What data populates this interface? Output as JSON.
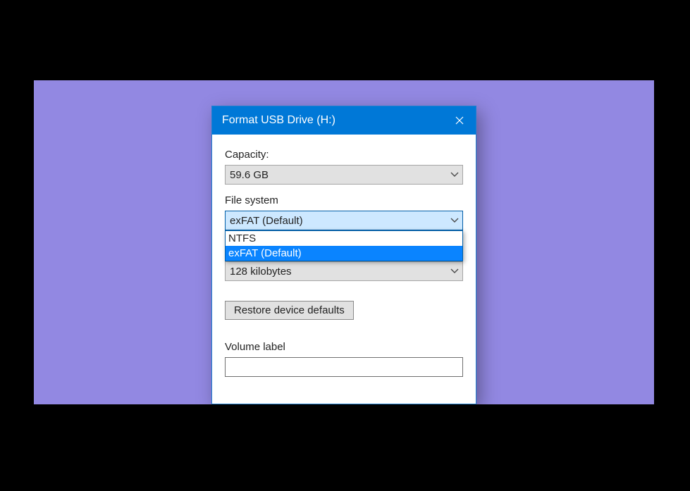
{
  "dialog": {
    "title": "Format USB Drive (H:)",
    "capacity": {
      "label": "Capacity:",
      "value": "59.6 GB"
    },
    "filesystem": {
      "label": "File system",
      "value": "exFAT (Default)",
      "options": [
        "NTFS",
        "exFAT (Default)"
      ],
      "selected_index": 1
    },
    "allocation": {
      "value": "128 kilobytes"
    },
    "restore_defaults_label": "Restore device defaults",
    "volume_label": {
      "label": "Volume label",
      "value": ""
    }
  }
}
